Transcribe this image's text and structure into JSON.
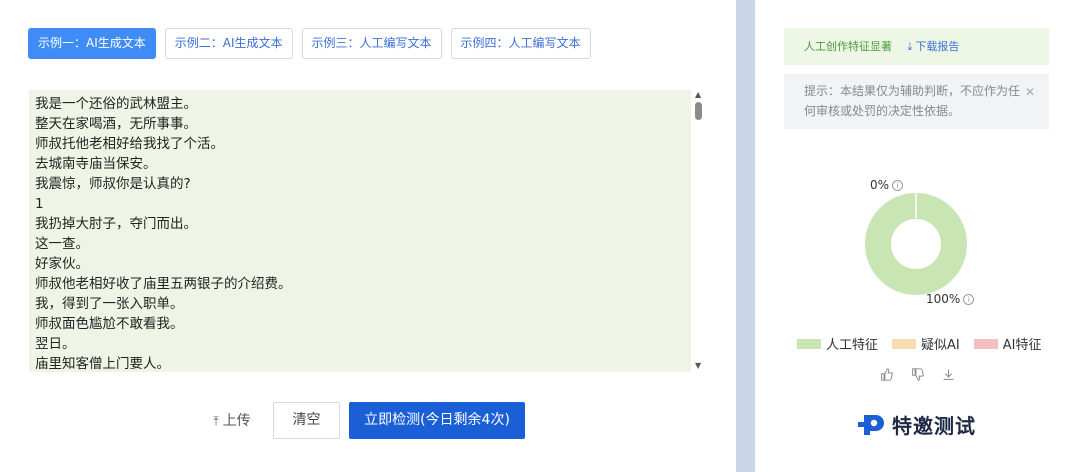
{
  "tabs": [
    {
      "label": "示例一：AI生成文本",
      "active": true
    },
    {
      "label": "示例二：AI生成文本",
      "active": false
    },
    {
      "label": "示例三：人工编写文本",
      "active": false
    },
    {
      "label": "示例四：人工编写文本",
      "active": false
    }
  ],
  "editor": {
    "lines": [
      "我是一个还俗的武林盟主。",
      "整天在家喝酒，无所事事。",
      "师叔托他老相好给我找了个活。",
      "去城南寺庙当保安。",
      "我震惊，师叔你是认真的?",
      "1",
      "我扔掉大肘子，夺门而出。",
      "这一查。",
      "好家伙。",
      "师叔他老相好收了庙里五两银子的介绍费。",
      "我，得到了一张入职单。",
      "师叔面色尴尬不敢看我。",
      "翌日。",
      "庙里知客僧上门要人。"
    ]
  },
  "actions": {
    "upload_label": "上传",
    "clear_label": "清空",
    "detect_label": "立即检测(今日剩余4次)"
  },
  "result": {
    "verdict": "人工创作特征显著",
    "download_label": "下载报告",
    "tip": "提示：本结果仅为辅助判断，不应作为任何审核或处罚的决定性依据。",
    "top_pct": "0%",
    "bottom_pct": "100%",
    "human_fraction": 1.0
  },
  "legend": [
    {
      "label": "人工特征",
      "color": "#c9e5b4"
    },
    {
      "label": "疑似AI",
      "color": "#f6dcb0"
    },
    {
      "label": "AI特征",
      "color": "#f5c0c0"
    }
  ],
  "brand": {
    "name": "特邀测试"
  },
  "colors": {
    "accent": "#1a5fd6",
    "tab_active": "#3f8cf6",
    "human": "#c9e5b4"
  }
}
